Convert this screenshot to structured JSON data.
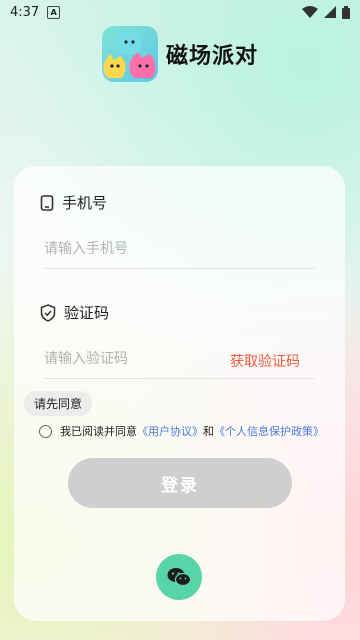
{
  "status_bar": {
    "time": "4:37"
  },
  "header": {
    "title": "磁场派对"
  },
  "phone": {
    "label": "手机号",
    "placeholder": "请输入手机号",
    "value": ""
  },
  "code": {
    "label": "验证码",
    "placeholder": "请输入验证码",
    "value": "",
    "get_code_label": "获取验证码"
  },
  "tooltip": "请先同意",
  "agreement": {
    "prefix": "我已阅读并同意",
    "user_agreement": "《用户协议》",
    "conjunction": "和",
    "privacy_policy": "《个人信息保护政策》"
  },
  "login_label": "登录",
  "colors": {
    "accent_red": "#f05a3c",
    "link_blue": "#4a7bd8",
    "wechat_green": "#58d5a8",
    "disabled_button": "#cfcfcf"
  },
  "icons": [
    "wifi-icon",
    "signal-icon",
    "battery-icon",
    "phone-icon",
    "shield-icon",
    "wechat-icon"
  ]
}
